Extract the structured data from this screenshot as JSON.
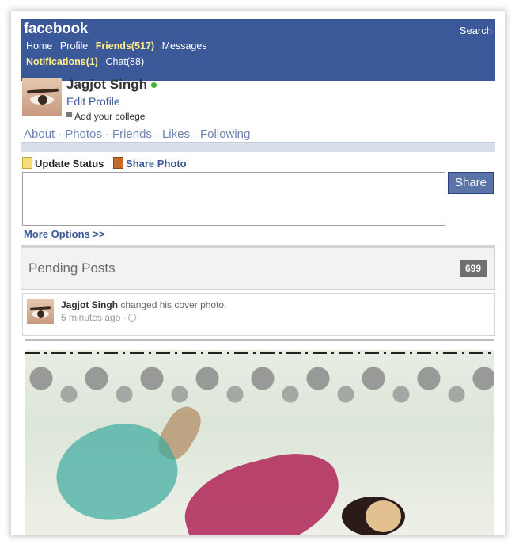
{
  "header": {
    "logo": "facebook",
    "search_label": "Search",
    "nav": {
      "home": "Home",
      "profile": "Profile",
      "friends": "Friends(517)",
      "messages": "Messages",
      "notifications": "Notifications(1)",
      "chat": "Chat(88)"
    }
  },
  "profile": {
    "name": "Jagjot Singh",
    "edit_label": "Edit Profile",
    "college_label": "Add your college",
    "tabs": [
      "About",
      "Photos",
      "Friends",
      "Likes",
      "Following"
    ],
    "separator": "·"
  },
  "composer": {
    "update_status": "Update Status",
    "share_photo": "Share Photo",
    "share_button": "Share",
    "more_options": "More Options >>"
  },
  "pending": {
    "label": "Pending Posts",
    "count": "699"
  },
  "post": {
    "author": "Jagjot Singh",
    "action": "changed his cover photo.",
    "time": "5 minutes ago ·"
  },
  "colors": {
    "brand": "#3b5998",
    "highlight": "#ffee88",
    "online": "#42b72a"
  }
}
